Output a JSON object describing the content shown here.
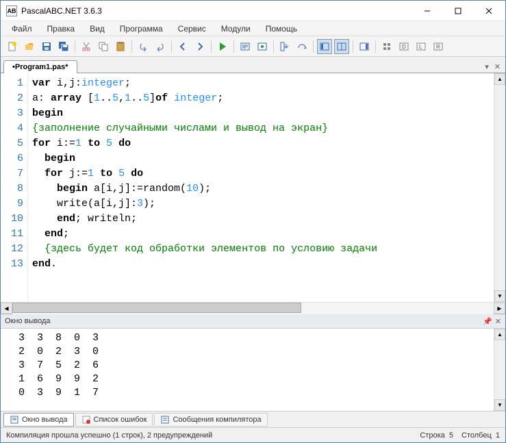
{
  "window": {
    "title": "PascalABC.NET 3.6.3",
    "icon_label": "AB"
  },
  "menu": [
    "Файл",
    "Правка",
    "Вид",
    "Программа",
    "Сервис",
    "Модули",
    "Помощь"
  ],
  "tab": {
    "label": "•Program1.pas*"
  },
  "code": {
    "lines": [
      {
        "n": "1",
        "pre": "",
        "tokens": [
          {
            "t": "var",
            "c": "kw"
          },
          {
            "t": " i,j:",
            "c": ""
          },
          {
            "t": "integer",
            "c": "ty"
          },
          {
            "t": ";",
            "c": ""
          }
        ]
      },
      {
        "n": "2",
        "pre": "",
        "tokens": [
          {
            "t": "a: ",
            "c": ""
          },
          {
            "t": "array",
            "c": "kw"
          },
          {
            "t": " [",
            "c": ""
          },
          {
            "t": "1",
            "c": "nu"
          },
          {
            "t": "..",
            "c": ""
          },
          {
            "t": "5",
            "c": "nu"
          },
          {
            "t": ",",
            "c": ""
          },
          {
            "t": "1",
            "c": "nu"
          },
          {
            "t": "..",
            "c": ""
          },
          {
            "t": "5",
            "c": "nu"
          },
          {
            "t": "]",
            "c": ""
          },
          {
            "t": "of",
            "c": "kw"
          },
          {
            "t": " ",
            "c": ""
          },
          {
            "t": "integer",
            "c": "ty"
          },
          {
            "t": ";",
            "c": ""
          }
        ]
      },
      {
        "n": "3",
        "pre": "",
        "tokens": [
          {
            "t": "begin",
            "c": "kw"
          }
        ]
      },
      {
        "n": "4",
        "pre": "",
        "tokens": [
          {
            "t": "{заполнение случайными числами и вывод на экран}",
            "c": "cm"
          }
        ]
      },
      {
        "n": "5",
        "pre": "",
        "tokens": [
          {
            "t": "for",
            "c": "kw"
          },
          {
            "t": " i:=",
            "c": ""
          },
          {
            "t": "1",
            "c": "nu"
          },
          {
            "t": " ",
            "c": ""
          },
          {
            "t": "to",
            "c": "kw"
          },
          {
            "t": " ",
            "c": ""
          },
          {
            "t": "5",
            "c": "nu"
          },
          {
            "t": " ",
            "c": ""
          },
          {
            "t": "do",
            "c": "kw"
          }
        ]
      },
      {
        "n": "6",
        "pre": "  ",
        "tokens": [
          {
            "t": "begin",
            "c": "kw"
          }
        ]
      },
      {
        "n": "7",
        "pre": "  ",
        "tokens": [
          {
            "t": "for",
            "c": "kw"
          },
          {
            "t": " j:=",
            "c": ""
          },
          {
            "t": "1",
            "c": "nu"
          },
          {
            "t": " ",
            "c": ""
          },
          {
            "t": "to",
            "c": "kw"
          },
          {
            "t": " ",
            "c": ""
          },
          {
            "t": "5",
            "c": "nu"
          },
          {
            "t": " ",
            "c": ""
          },
          {
            "t": "do",
            "c": "kw"
          }
        ]
      },
      {
        "n": "8",
        "pre": "    ",
        "tokens": [
          {
            "t": "begin",
            "c": "kw"
          },
          {
            "t": " a[i,j]:=random(",
            "c": ""
          },
          {
            "t": "10",
            "c": "nu"
          },
          {
            "t": ");",
            "c": ""
          }
        ]
      },
      {
        "n": "9",
        "pre": "    ",
        "tokens": [
          {
            "t": "write(a[i,j]:",
            "c": ""
          },
          {
            "t": "3",
            "c": "nu"
          },
          {
            "t": ");",
            "c": ""
          }
        ]
      },
      {
        "n": "10",
        "pre": "    ",
        "tokens": [
          {
            "t": "end",
            "c": "kw"
          },
          {
            "t": "; writeln;",
            "c": ""
          }
        ]
      },
      {
        "n": "11",
        "pre": "  ",
        "tokens": [
          {
            "t": "end",
            "c": "kw"
          },
          {
            "t": ";",
            "c": ""
          }
        ]
      },
      {
        "n": "12",
        "pre": "  ",
        "tokens": [
          {
            "t": "{здесь будет код обработки элементов по условию задачи",
            "c": "cm"
          }
        ]
      },
      {
        "n": "13",
        "pre": "",
        "tokens": [
          {
            "t": "end",
            "c": "kw"
          },
          {
            "t": ".",
            "c": ""
          }
        ]
      }
    ]
  },
  "output_panel": {
    "title": "Окно вывода",
    "rows": [
      "  3  3  8  0  3",
      "  2  0  2  3  0",
      "  3  7  5  2  6",
      "  1  6  9  9  2",
      "  0  3  9  1  7"
    ]
  },
  "bottom_tabs": {
    "output": "Окно вывода",
    "errors": "Список ошибок",
    "compiler": "Сообщения компилятора"
  },
  "status": {
    "left": "Компиляция прошла успешно (1 строк), 2 предупреждений",
    "line_label": "Строка",
    "line": "5",
    "col_label": "Столбец",
    "col": "1"
  }
}
